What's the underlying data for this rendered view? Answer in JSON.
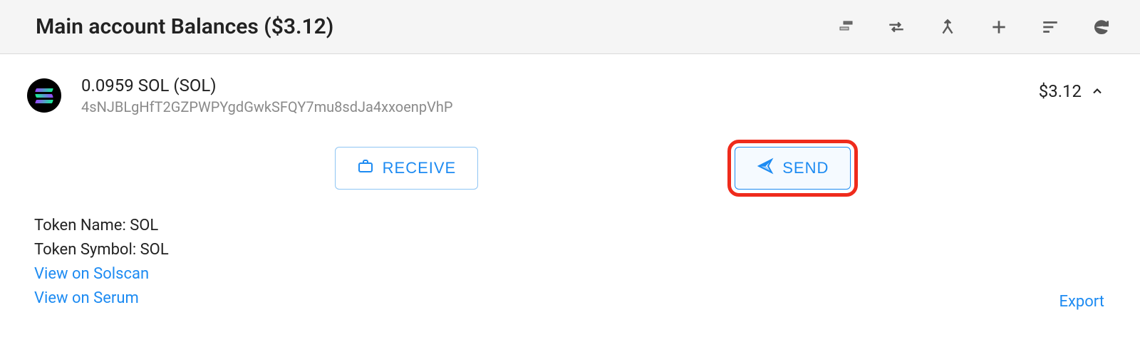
{
  "header": {
    "title": "Main account Balances ($3.12)"
  },
  "token": {
    "title": "0.0959 SOL (SOL)",
    "address": "4sNJBLgHfT2GZPWPYgdGwkSFQY7mu8sdJa4xxoenpVhP",
    "value": "$3.12"
  },
  "buttons": {
    "receive": "RECEIVE",
    "send": "SEND"
  },
  "details": {
    "token_name": "Token Name: SOL",
    "token_symbol": "Token Symbol: SOL",
    "view_solscan": "View on Solscan",
    "view_serum": "View on Serum",
    "export": "Export"
  }
}
